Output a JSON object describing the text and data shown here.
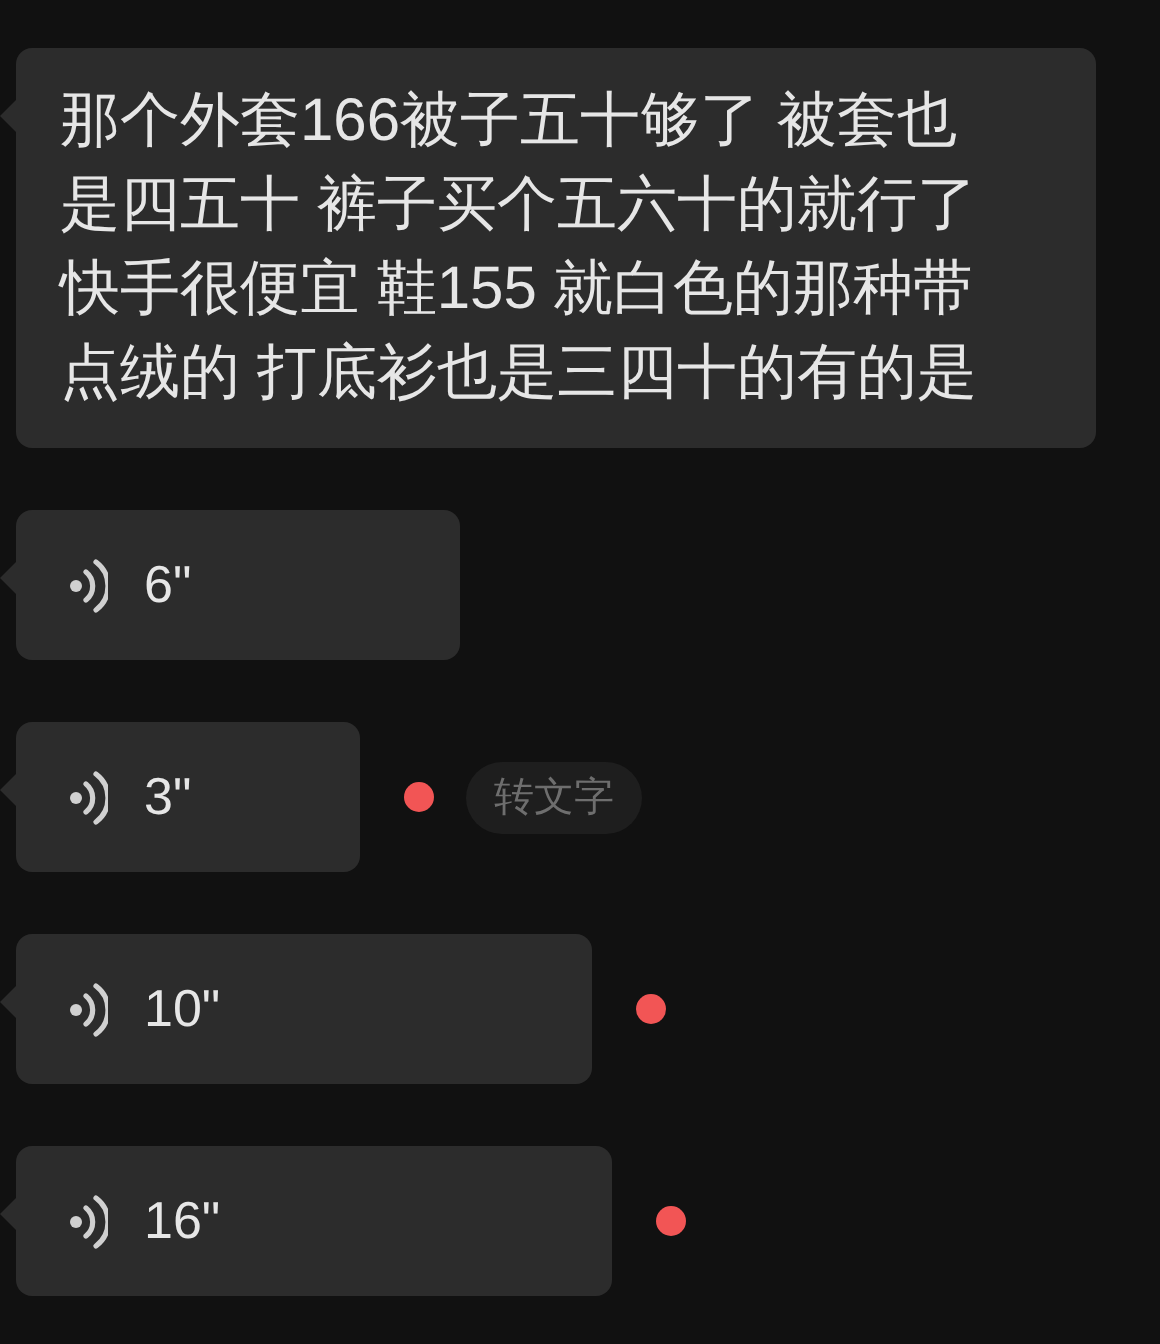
{
  "messages": [
    {
      "kind": "text",
      "text": "那个外套166被子五十够了 被套也是四五十 裤子买个五六十的就行了快手很便宜 鞋155 就白色的那种带点绒的 打底衫也是三四十的有的是"
    },
    {
      "kind": "voice",
      "duration": "6\"",
      "unread": false
    },
    {
      "kind": "voice",
      "duration": "3\"",
      "unread": true,
      "transcribe": "转文字"
    },
    {
      "kind": "voice",
      "duration": "10\"",
      "unread": true
    },
    {
      "kind": "voice",
      "duration": "16\"",
      "unread": true
    }
  ]
}
